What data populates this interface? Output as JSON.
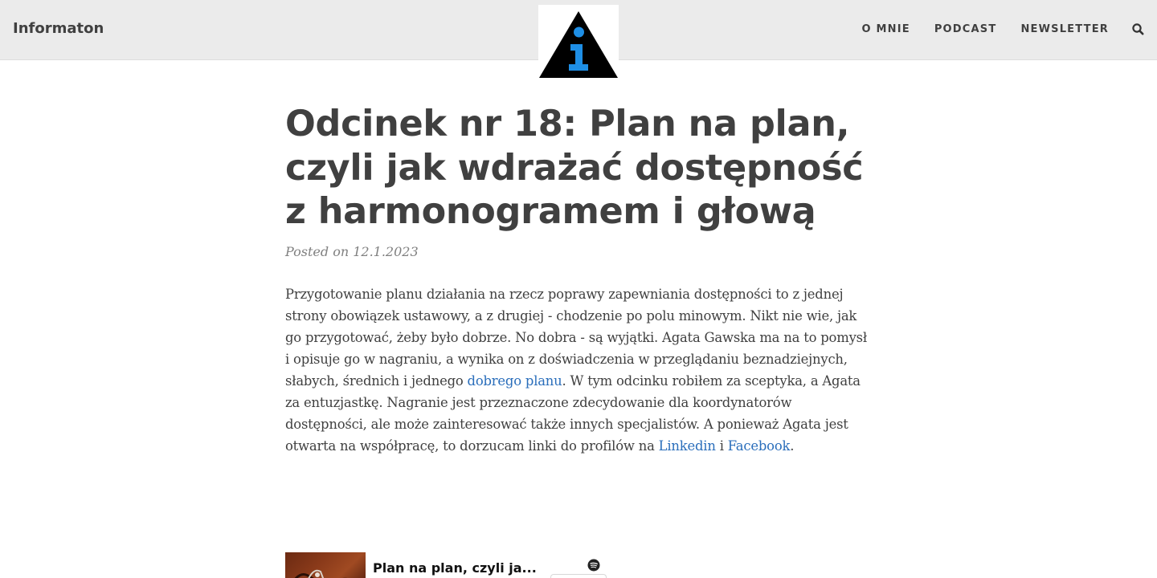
{
  "header": {
    "site_title": "Informaton",
    "nav": [
      {
        "label": "O MNIE"
      },
      {
        "label": "PODCAST"
      },
      {
        "label": "NEWSLETTER"
      }
    ],
    "logo_icon": "info-triangle-logo-icon",
    "search_icon": "search-icon"
  },
  "post": {
    "title": "Odcinek nr 18: Plan na plan, czyli jak wdrażać dostępność z harmonogramem i głową",
    "meta": "Posted on 12.1.2023",
    "body": {
      "p1": "Przygotowanie planu działania na rzecz poprawy zapewniania dostępności to z jednej strony obowiązek ustawowy, a z drugiej - chodzenie po polu minowym. Nikt nie wie, jak go przygotować, żeby było dobrze. No dobra - są wyjątki. Agata Gawska ma na to pomysł i opisuje go w nagraniu, a wynika on z doświadczenia w przeglądaniu beznadziejnych, słabych, średnich i jednego ",
      "link1": "dobrego planu",
      "p2": ". W tym odcinku robiłem za sceptyka, a Agata za entuzjastkę. Nagranie jest przeznaczone zdecydowanie dla koordynatorów dostępności, ale może zainteresować także innych specjalistów. A ponieważ Agata jest otwarta na współpracę, to dorzucam linki do profilów na ",
      "link2": "Linkedin",
      "p3": " i ",
      "link3": "Facebook",
      "p4": "."
    }
  },
  "embed": {
    "title": "Plan na plan, czyli ja...",
    "spotify_icon": "spotify-icon"
  },
  "colors": {
    "header_bg": "#ebebeb",
    "text": "#404040",
    "link": "#2a6ebb",
    "logo_blue": "#1e8fe6"
  }
}
